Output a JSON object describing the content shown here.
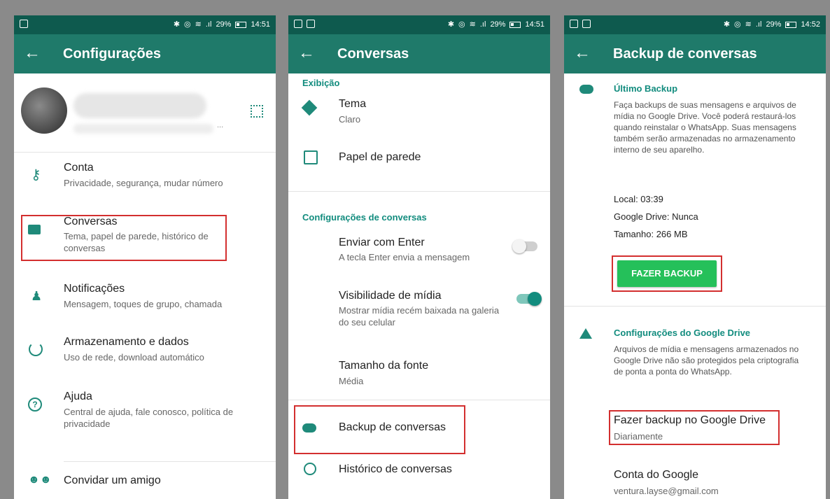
{
  "status": {
    "battery": "29%",
    "signal": ".ıl",
    "time1": "14:51",
    "time2": "14:51",
    "time3": "14:52"
  },
  "screen1": {
    "title": "Configurações",
    "back_icon": "arrow-left-icon",
    "profile_more": "...",
    "items": [
      {
        "title": "Conta",
        "sub": "Privacidade, segurança, mudar número",
        "icon": "key-icon"
      },
      {
        "title": "Conversas",
        "sub": "Tema, papel de parede, histórico de conversas",
        "icon": "chat-icon"
      },
      {
        "title": "Notificações",
        "sub": "Mensagem, toques de grupo, chamada",
        "icon": "bell-icon"
      },
      {
        "title": "Armazenamento e dados",
        "sub": "Uso de rede, download automático",
        "icon": "data-usage-icon"
      },
      {
        "title": "Ajuda",
        "sub": "Central de ajuda, fale conosco, política de privacidade",
        "icon": "help-icon"
      },
      {
        "title": "Convidar um amigo",
        "sub": "",
        "icon": "people-icon"
      }
    ]
  },
  "screen2": {
    "title": "Conversas",
    "section_display": "Exibição",
    "theme_title": "Tema",
    "theme_value": "Claro",
    "wallpaper": "Papel de parede",
    "section_chats": "Configurações de conversas",
    "enter_title": "Enviar com Enter",
    "enter_sub": "A tecla Enter envia a mensagem",
    "enter_on": false,
    "media_title": "Visibilidade de mídia",
    "media_sub": "Mostrar mídia recém baixada na galeria do seu celular",
    "media_on": true,
    "font_title": "Tamanho da fonte",
    "font_value": "Média",
    "backup": "Backup de conversas",
    "history": "Histórico de conversas"
  },
  "screen3": {
    "title": "Backup de conversas",
    "last_backup_head": "Último Backup",
    "last_backup_desc": "Faça backups de suas mensagens e arquivos de mídia no Google Drive. Você poderá restaurá-los quando reinstalar o WhatsApp. Suas mensagens também serão armazenadas no armazenamento interno de seu aparelho.",
    "local": "Local: 03:39",
    "gdrive": "Google Drive: Nunca",
    "size": "Tamanho: 266 MB",
    "backup_button": "FAZER BACKUP",
    "gdrive_head": "Configurações do Google Drive",
    "gdrive_desc": "Arquivos de mídia e mensagens armazenados no Google Drive não são protegidos pela criptografia de ponta a ponta do WhatsApp.",
    "backup_to_drive": "Fazer backup no Google Drive",
    "frequency": "Diariamente",
    "account_title": "Conta do Google",
    "account_email": "ventura.layse@gmail.com"
  },
  "colors": {
    "statusbar": "#0e5a4e",
    "appbar": "#1f7a6a",
    "accent": "#128c7e",
    "button": "#25c05a",
    "highlight": "#d32f2f"
  }
}
